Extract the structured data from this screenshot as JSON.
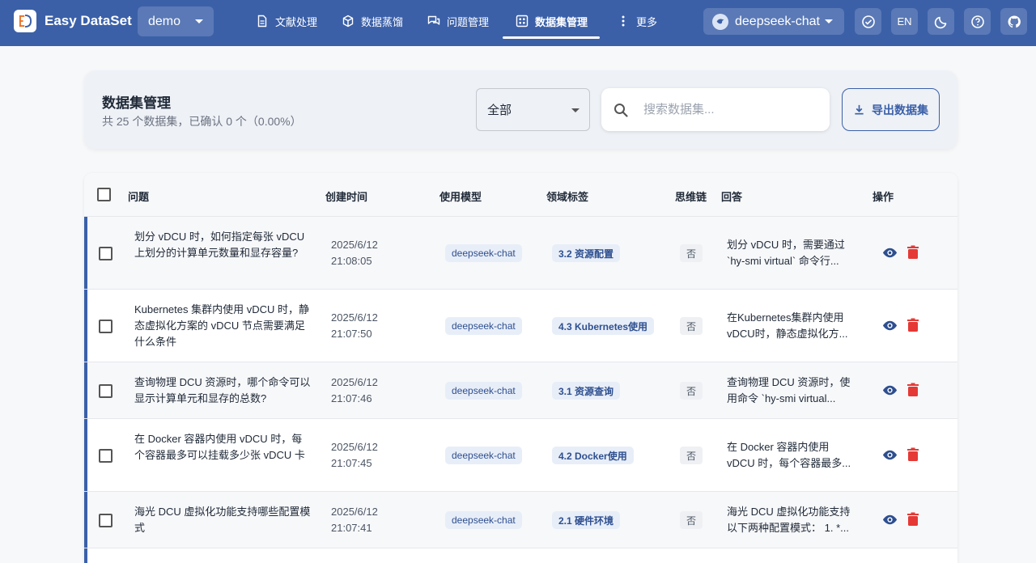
{
  "app": {
    "title": "Easy DataSet",
    "project": "demo"
  },
  "nav": [
    {
      "label": "文献处理",
      "icon": "document-icon"
    },
    {
      "label": "数据蒸馏",
      "icon": "cube-icon"
    },
    {
      "label": "问题管理",
      "icon": "chat-icon"
    },
    {
      "label": "数据集管理",
      "icon": "grid-icon",
      "active": true
    },
    {
      "label": "更多",
      "icon": "more-vertical-icon"
    }
  ],
  "model": {
    "name": "deepseek-chat"
  },
  "toolbar": {
    "language": "EN"
  },
  "page": {
    "title": "数据集管理",
    "subtitle": "共 25 个数据集，已确认 0 个（0.00%）",
    "filter_value": "全部",
    "search_placeholder": "搜索数据集...",
    "export_label": "导出数据集"
  },
  "table": {
    "headers": {
      "question": "问题",
      "created": "创建时间",
      "model": "使用模型",
      "tag": "领域标签",
      "cot": "思维链",
      "answer": "回答",
      "actions": "操作"
    },
    "rows": [
      {
        "question": "划分 vDCU 时，如何指定每张 vDCU 上划分的计算单元数量和显存容量?",
        "date": "2025/6/12",
        "time": "21:08:05",
        "model": "deepseek-chat",
        "tag": "3.2 资源配置",
        "cot": "否",
        "answer": "划分 vDCU 时，需要通过 `hy-smi virtual` 命令行..."
      },
      {
        "question": "Kubernetes 集群内使用 vDCU 时，静态虚拟化方案的 vDCU 节点需要满足什么条件",
        "date": "2025/6/12",
        "time": "21:07:50",
        "model": "deepseek-chat",
        "tag": "4.3 Kubernetes使用",
        "cot": "否",
        "answer": "在Kubernetes集群内使用vDCU时，静态虚拟化方..."
      },
      {
        "question": "查询物理 DCU 资源时，哪个命令可以显示计算单元和显存的总数?",
        "date": "2025/6/12",
        "time": "21:07:46",
        "model": "deepseek-chat",
        "tag": "3.1 资源查询",
        "cot": "否",
        "answer": "查询物理 DCU 资源时，使用命令 `hy-smi virtual..."
      },
      {
        "question": "在 Docker 容器内使用 vDCU 时，每个容器最多可以挂载多少张 vDCU 卡",
        "date": "2025/6/12",
        "time": "21:07:45",
        "model": "deepseek-chat",
        "tag": "4.2 Docker使用",
        "cot": "否",
        "answer": "在 Docker 容器内使用 vDCU 时，每个容器最多..."
      },
      {
        "question": "海光 DCU 虚拟化功能支持哪些配置模式",
        "date": "2025/6/12",
        "time": "21:07:41",
        "model": "deepseek-chat",
        "tag": "2.1 硬件环境",
        "cot": "否",
        "answer": "海光 DCU 虚拟化功能支持以下两种配置模式： 1. *..."
      }
    ]
  },
  "colors": {
    "primary": "#3b60a8",
    "danger": "#e53935",
    "chip_bg": "#e8eef8"
  }
}
